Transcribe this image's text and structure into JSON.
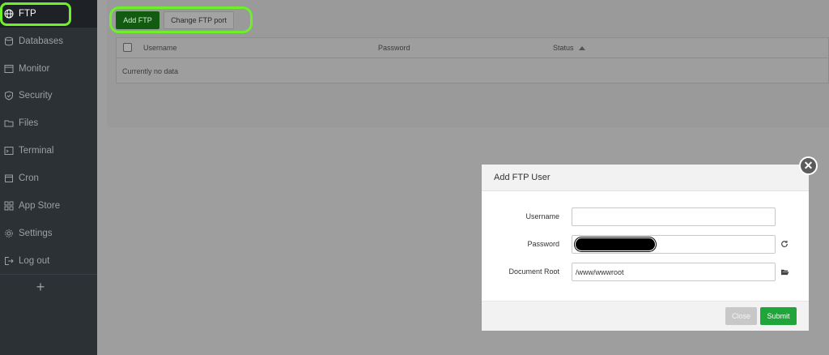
{
  "sidebar": {
    "items": [
      {
        "label": "FTP",
        "icon": "globe-icon",
        "active": true
      },
      {
        "label": "Databases",
        "icon": "database-icon"
      },
      {
        "label": "Monitor",
        "icon": "monitor-icon"
      },
      {
        "label": "Security",
        "icon": "shield-icon"
      },
      {
        "label": "Files",
        "icon": "folder-icon"
      },
      {
        "label": "Terminal",
        "icon": "terminal-icon"
      },
      {
        "label": "Cron",
        "icon": "calendar-icon"
      },
      {
        "label": "App Store",
        "icon": "grid-icon"
      },
      {
        "label": "Settings",
        "icon": "gear-icon"
      },
      {
        "label": "Log out",
        "icon": "logout-icon"
      }
    ],
    "add_label": "+"
  },
  "toolbar": {
    "add_ftp_label": "Add FTP",
    "change_port_label": "Change FTP port"
  },
  "table": {
    "columns": [
      "Username",
      "Password",
      "Status"
    ],
    "empty_text": "Currently no data"
  },
  "modal": {
    "title": "Add FTP User",
    "fields": {
      "username": {
        "label": "Username",
        "value": ""
      },
      "password": {
        "label": "Password",
        "value": ""
      },
      "document_root": {
        "label": "Document Root",
        "value": "/www/wwwroot"
      }
    },
    "close_label": "Close",
    "submit_label": "Submit",
    "close_x": "✕"
  },
  "colors": {
    "accent_green": "#20a53a",
    "highlight": "#6df02a",
    "sidebar_bg": "#2c3135"
  }
}
